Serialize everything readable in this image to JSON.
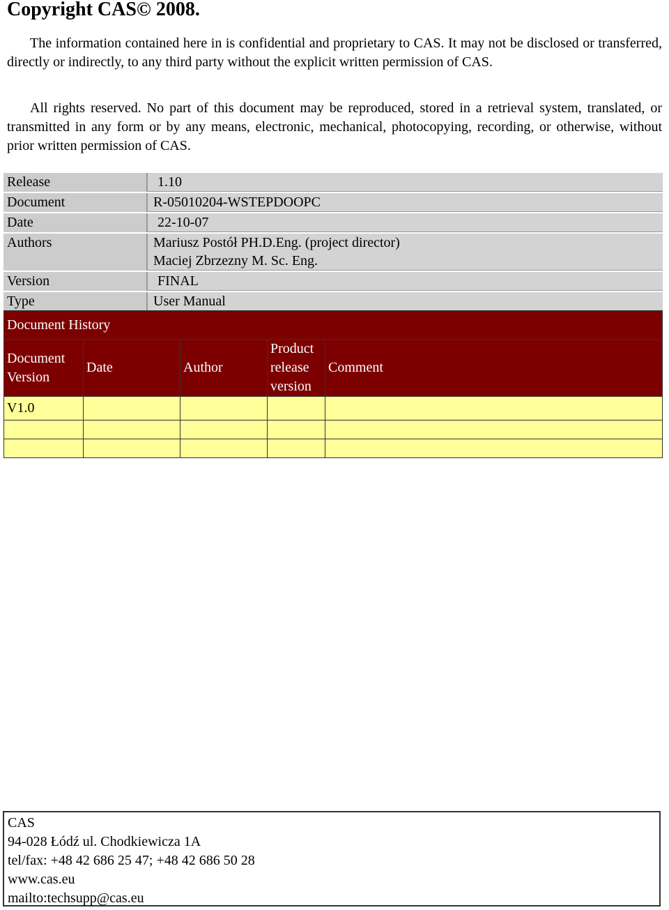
{
  "title": "Copyright CAS©  2008.",
  "paragraphs": [
    "The information contained here in is confidential and proprietary to CAS. It may not be disclosed or transferred, directly or indirectly, to any third party without the explicit written permission of CAS.",
    "All rights reserved. No part of this document may be reproduced, stored in a retrieval system, translated, or transmitted in any form or by any means, electronic, mechanical, photocopying, recording, or otherwise, without prior written permission of CAS."
  ],
  "meta": {
    "release": {
      "label": "Release",
      "value": "1.10"
    },
    "document": {
      "label": "Document",
      "value": "R-05010204-WSTEPDOOPC"
    },
    "date": {
      "label": "Date",
      "value": "22-10-07"
    },
    "authors": {
      "label": "Authors",
      "value1": "Mariusz Postół PH.D.Eng. (project director)",
      "value2": "Maciej Zbrzezny M. Sc. Eng."
    },
    "version": {
      "label": "Version",
      "value": "FINAL"
    },
    "type": {
      "label": "Type",
      "value": "User Manual"
    }
  },
  "history": {
    "title": "Document History",
    "columns": [
      "Document Version",
      "Date",
      "Author",
      "Product release version",
      "Comment"
    ],
    "rows": [
      [
        "V1.0",
        "",
        "",
        "",
        ""
      ],
      [
        "",
        "",
        "",
        "",
        ""
      ],
      [
        "",
        "",
        "",
        "",
        ""
      ]
    ]
  },
  "footer": {
    "company": "CAS",
    "address": "94-028 Łódź  ul. Chodkiewicza 1A",
    "phone": "tel/fax: +48 42 686 25 47; +48 42 686 50 28",
    "website": "www.cas.eu",
    "email": "mailto:techsupp@cas.eu"
  }
}
